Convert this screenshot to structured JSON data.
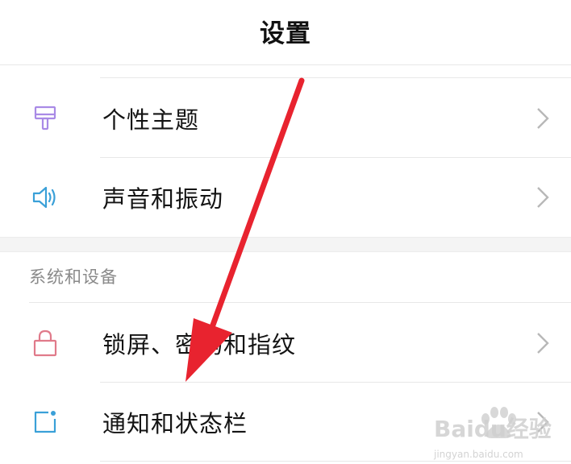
{
  "header": {
    "title": "设置"
  },
  "group1": {
    "items": [
      {
        "label": "个性主题",
        "icon": "paint-brush-icon",
        "icon_color": "#a98ae6"
      },
      {
        "label": "声音和振动",
        "icon": "speaker-icon",
        "icon_color": "#3aa0d8"
      }
    ]
  },
  "group2": {
    "title": "系统和设备",
    "items": [
      {
        "label": "锁屏、密码和指纹",
        "icon": "lock-icon",
        "icon_color": "#e07a8a"
      },
      {
        "label": "通知和状态栏",
        "icon": "notification-icon",
        "icon_color": "#3aa0d8"
      }
    ]
  },
  "overlay": {
    "arrow_color": "#e8232f"
  },
  "watermark": {
    "brand": "Baidu经验",
    "url": "jingyan.baidu.com"
  }
}
